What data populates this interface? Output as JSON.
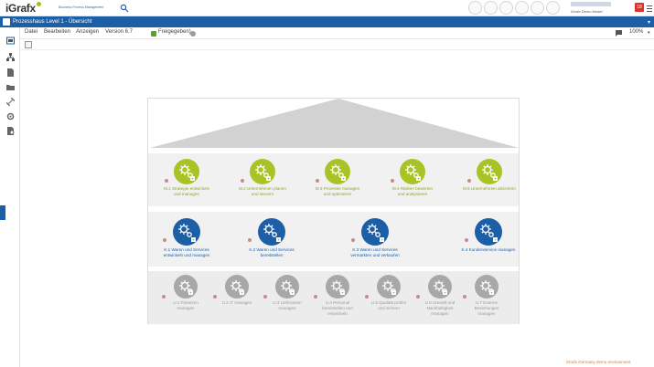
{
  "header": {
    "logo_text": "iGrafx",
    "tagline": "Business Process Management",
    "user_model": "iGrafx Demo Model",
    "notification_count": "18"
  },
  "titlebar": {
    "title": "Prozesshaus Level 1 - Übersicht"
  },
  "menu": {
    "items": [
      "Datei",
      "Bearbeiten",
      "Anzeigen"
    ],
    "version_label": "Version 6.7",
    "status_label": "Freigegeben)",
    "zoom": "100%"
  },
  "house": {
    "management": [
      {
        "id": "m1",
        "line1": "M.1 Strategie entwickeln",
        "line2": "und managen"
      },
      {
        "id": "m2",
        "line1": "M.2 Unternehmen planen",
        "line2": "und steuern"
      },
      {
        "id": "m3",
        "line1": "M.3 Prozesse managen",
        "line2": "und optimieren"
      },
      {
        "id": "m4",
        "line1": "M.4 Risiken bewerten",
        "line2": "und analysieren"
      },
      {
        "id": "m5",
        "line1": "M.5 Unternehmen absichern",
        "line2": ""
      }
    ],
    "core": [
      {
        "id": "k1",
        "line1": "K.1 Waren und Services",
        "line2": "entwickeln und managen"
      },
      {
        "id": "k2",
        "line1": "K.2 Waren und Services",
        "line2": "bereitstellen"
      },
      {
        "id": "k3",
        "line1": "K.3 Waren und Services",
        "line2": "vermarkten und verkaufen"
      },
      {
        "id": "k4",
        "line1": "K.4 Kundenservice managen",
        "line2": ""
      }
    ],
    "support": [
      {
        "id": "u1",
        "line1": "U.1 Finanzen",
        "line2": "managen",
        "line3": ""
      },
      {
        "id": "u2",
        "line1": "U.2 IT managen",
        "line2": "",
        "line3": ""
      },
      {
        "id": "u3",
        "line1": "U.3 Lieferanten",
        "line2": "managen",
        "line3": ""
      },
      {
        "id": "u4",
        "line1": "U.4 Personal",
        "line2": "bereitstellen und",
        "line3": "entwickeln"
      },
      {
        "id": "u5",
        "line1": "U.5 Qualität prüfen",
        "line2": "und sichern",
        "line3": ""
      },
      {
        "id": "u6",
        "line1": "U.6 Umwelt und",
        "line2": "Nachhaltigkeit",
        "line3": "managen"
      },
      {
        "id": "u7",
        "line1": "U.7 Externe",
        "line2": "Beziehungen",
        "line3": "managen"
      }
    ]
  },
  "footer": {
    "environment_note": "iGrafx Germany demo environment"
  },
  "colors": {
    "brand_blue": "#1d5fa7",
    "management_green": "#a8c326",
    "support_grey": "#a8a8a8",
    "badge_red": "#d9342b"
  },
  "icons": [
    "search-icon",
    "gear-icon",
    "plus-icon",
    "info-icon",
    "comment-icon",
    "menu-icon"
  ]
}
